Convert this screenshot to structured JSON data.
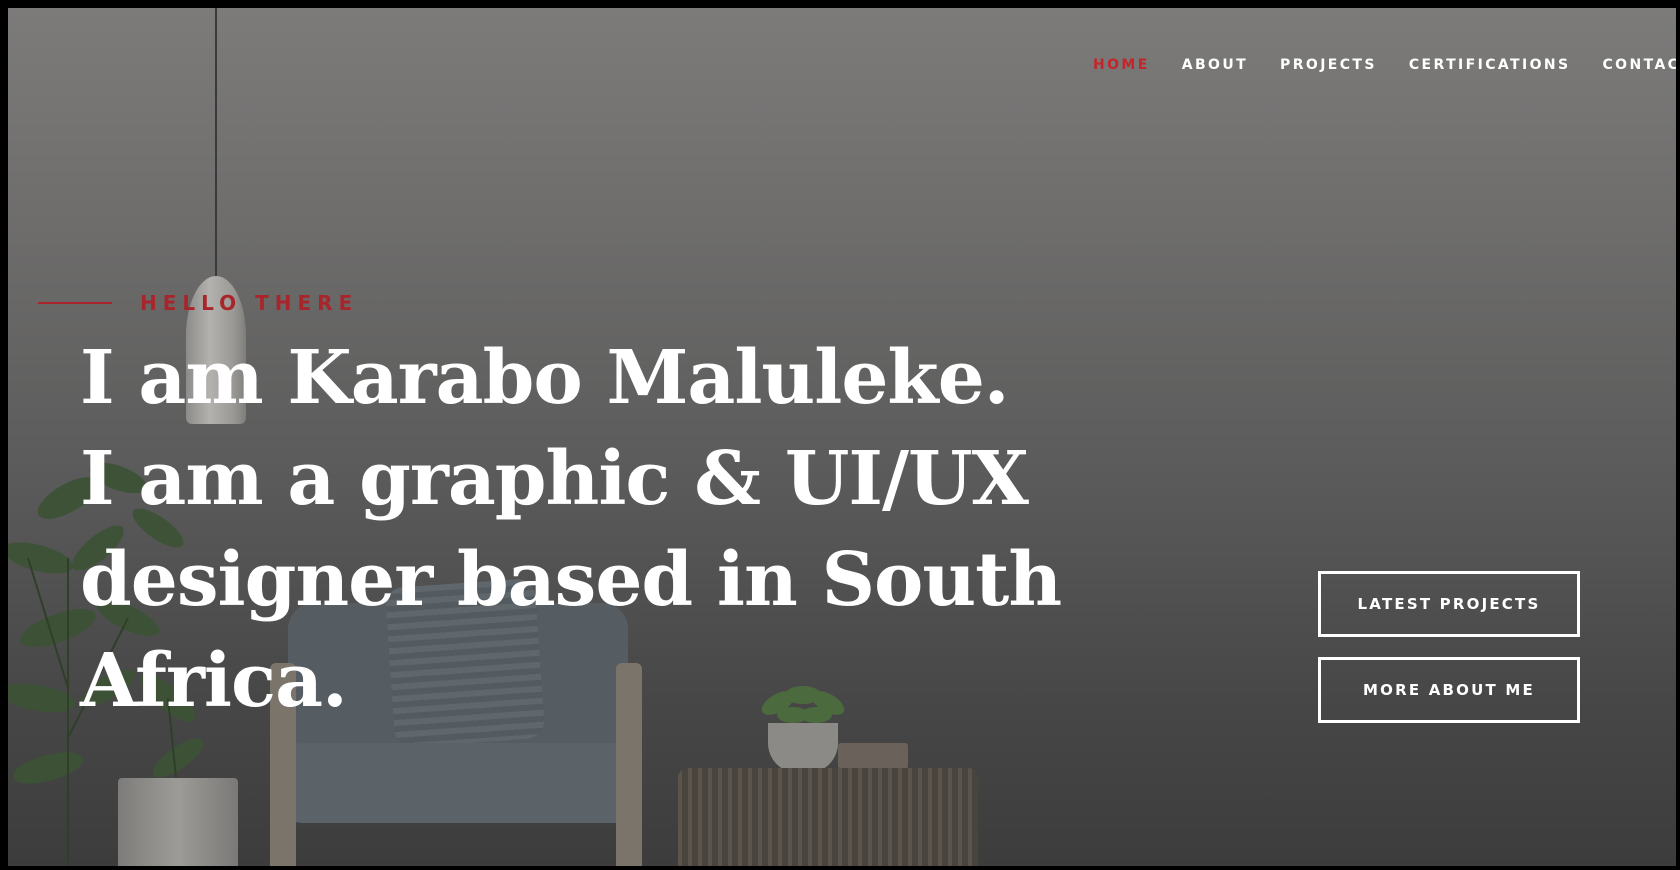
{
  "nav": {
    "items": [
      {
        "label": "HOME",
        "active": true
      },
      {
        "label": "ABOUT",
        "active": false
      },
      {
        "label": "PROJECTS",
        "active": false
      },
      {
        "label": "CERTIFICATIONS",
        "active": false
      },
      {
        "label": "CONTACT",
        "active": false
      }
    ]
  },
  "hero": {
    "kicker": "HELLO THERE",
    "headline_lines": [
      "I am Karabo Maluleke.",
      "I am a graphic & UI/UX",
      "designer based in South",
      "Africa."
    ]
  },
  "buttons": {
    "latest_projects": "LATEST PROJECTS",
    "more_about_me": "MORE ABOUT ME"
  },
  "colors": {
    "accent": "#c4242a",
    "kicker": "#a8262b",
    "text": "#ffffff",
    "overlay": "#5a5a5a"
  },
  "icons": [
    "pendant-lamp-image",
    "plant-image",
    "armchair-image",
    "side-table-image"
  ]
}
